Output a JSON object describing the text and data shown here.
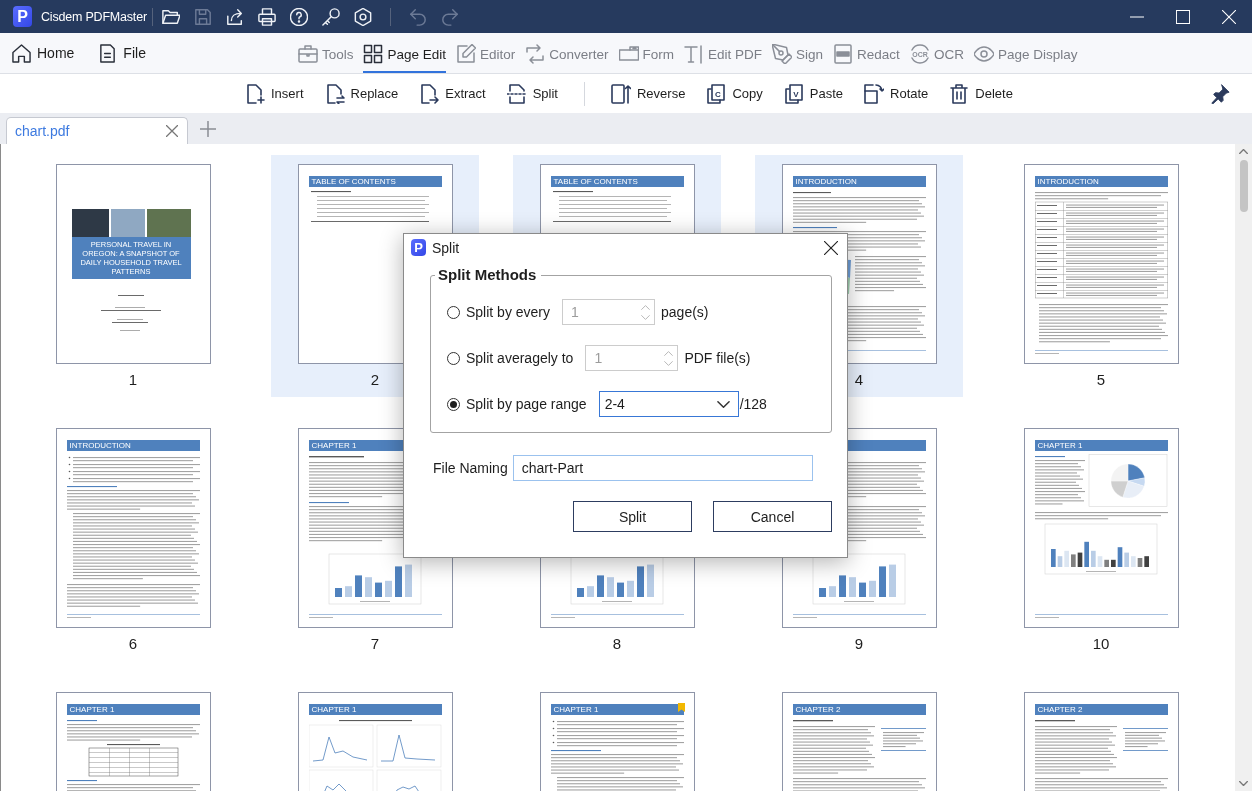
{
  "window": {
    "logo": "P",
    "title": "Cisdem PDFMaster",
    "quick_actions": [
      {
        "disabled": false
      },
      {
        "disabled": true
      },
      {
        "disabled": false
      },
      {
        "disabled": false
      },
      {
        "disabled": false
      },
      {
        "disabled": false
      },
      {
        "disabled": false
      },
      {
        "disabled": true
      },
      {
        "disabled": true
      }
    ]
  },
  "nav": {
    "left": [
      {
        "label": "Home"
      },
      {
        "label": "File"
      }
    ],
    "tabs": [
      {
        "label": "Tools",
        "selected": false
      },
      {
        "label": "Page Edit",
        "selected": true
      },
      {
        "label": "Editor",
        "selected": false
      },
      {
        "label": "Converter",
        "selected": false
      },
      {
        "label": "Form",
        "selected": false
      },
      {
        "label": "Edit PDF",
        "selected": false
      },
      {
        "label": "Sign",
        "selected": false
      },
      {
        "label": "Redact",
        "selected": false
      },
      {
        "label": "OCR",
        "selected": false,
        "icon_text": "OCR"
      },
      {
        "label": "Page Display",
        "selected": false
      }
    ]
  },
  "toolbar": {
    "groups": [
      [
        {
          "label": "Insert"
        },
        {
          "label": "Replace"
        },
        {
          "label": "Extract"
        },
        {
          "label": "Split"
        }
      ],
      [
        {
          "label": "Reverse"
        },
        {
          "label": "Copy",
          "icon_text": "C"
        },
        {
          "label": "Paste",
          "icon_text": "V"
        },
        {
          "label": "Rotate"
        },
        {
          "label": "Delete"
        }
      ]
    ]
  },
  "documents": [
    {
      "label": "chart.pdf",
      "selected": true
    }
  ],
  "pages": [
    {
      "number": "1",
      "selected": false,
      "bookmarked": false,
      "kind": "cover",
      "heading": "PERSONAL TRAVEL IN OREGON: A SNAPSHOT OF DAILY HOUSEHOLD TRAVEL PATTERNS"
    },
    {
      "number": "2",
      "selected": true,
      "bookmarked": false,
      "kind": "toc",
      "heading": "TABLE OF CONTENTS"
    },
    {
      "selected": true,
      "bookmarked": false,
      "kind": "toc",
      "heading": "TABLE OF CONTENTS"
    },
    {
      "number": "4",
      "selected": true,
      "bookmarked": false,
      "kind": "map",
      "heading": "INTRODUCTION"
    },
    {
      "number": "5",
      "selected": false,
      "bookmarked": false,
      "kind": "table",
      "heading": "INTRODUCTION"
    },
    {
      "number": "6",
      "selected": false,
      "bookmarked": false,
      "kind": "text",
      "heading": "INTRODUCTION"
    },
    {
      "number": "7",
      "selected": false,
      "bookmarked": false,
      "kind": "bar-chart",
      "heading": "CHAPTER 1"
    },
    {
      "number": "8",
      "selected": false,
      "bookmarked": false,
      "kind": "bar-chart"
    },
    {
      "number": "9",
      "selected": false,
      "bookmarked": false,
      "kind": "bar-chart"
    },
    {
      "number": "10",
      "selected": false,
      "bookmarked": false,
      "kind": "pie-chart",
      "heading": "CHAPTER 1"
    },
    {
      "selected": false,
      "bookmarked": false,
      "kind": "table-text",
      "heading": "CHAPTER 1"
    },
    {
      "selected": false,
      "bookmarked": false,
      "kind": "line-chart",
      "heading": "CHAPTER 1"
    },
    {
      "selected": false,
      "bookmarked": true,
      "kind": "text",
      "heading": "CHAPTER 1"
    },
    {
      "selected": false,
      "bookmarked": false,
      "kind": "sidebar",
      "heading": "CHAPTER 2"
    },
    {
      "selected": false,
      "bookmarked": false,
      "kind": "sidebar",
      "heading": "CHAPTER 2"
    }
  ],
  "dialog": {
    "logo": "P",
    "title": "Split",
    "group_title": "Split Methods",
    "methods": [
      {
        "kind": "spin",
        "label": "Split by every",
        "value": "1",
        "unit": "page(s)",
        "selected": false
      },
      {
        "kind": "spin",
        "label": "Split averagely to",
        "value": "1",
        "unit": "PDF file(s)",
        "selected": false
      },
      {
        "kind": "combo",
        "label": "Split by page range",
        "value": "2-4",
        "unit": "/128",
        "selected": true
      }
    ],
    "file_naming": {
      "label": "File Naming",
      "value": "chart-Part"
    },
    "buttons": [
      "Split",
      "Cancel"
    ]
  }
}
